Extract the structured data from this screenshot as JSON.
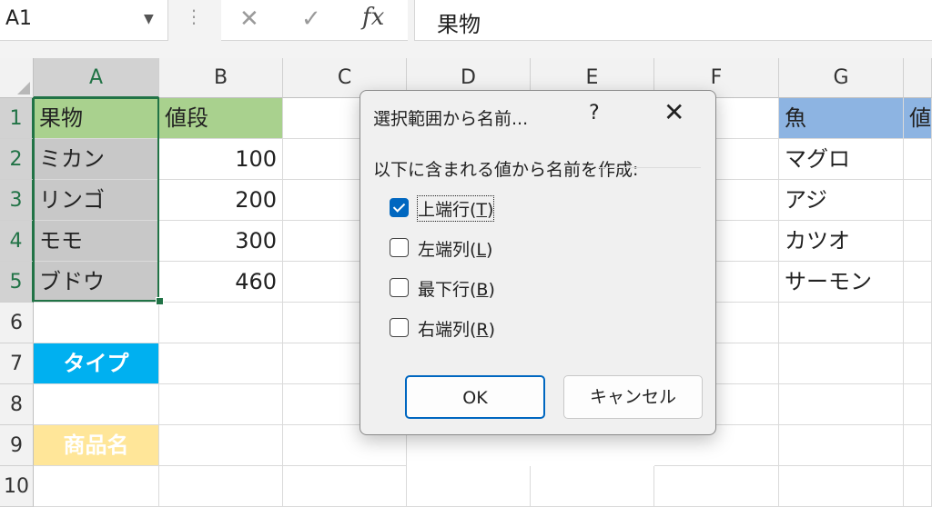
{
  "formula_bar": {
    "name_box": "A1",
    "dots": "⋮",
    "cancel_icon": "✕",
    "enter_icon": "✓",
    "fx_label": "fx",
    "value": "果物"
  },
  "columns": [
    "A",
    "B",
    "C",
    "D",
    "E",
    "F",
    "G"
  ],
  "rows": [
    "1",
    "2",
    "3",
    "4",
    "5",
    "6",
    "7",
    "8",
    "9",
    "10"
  ],
  "cells": {
    "A1": "果物",
    "B1": "値段",
    "A2": "ミカン",
    "B2": "100",
    "A3": "リンゴ",
    "B3": "200",
    "A4": "モモ",
    "B4": "300",
    "A5": "ブドウ",
    "B5": "460",
    "A7": "タイプ",
    "A9": "商品名",
    "G1": "魚",
    "H1": "値",
    "G2": "マグロ",
    "G3": "アジ",
    "G4": "カツオ",
    "G5": "サーモン"
  },
  "colors": {
    "header_green": "#a9d18e",
    "selection_gray": "#c8c8c8",
    "header_blue": "#8db4e2",
    "type_cyan": "#00b0f0",
    "name_yellow": "#ffe699",
    "excel_green": "#217346",
    "check_blue": "#0067c0"
  },
  "dialog": {
    "title": "選択範囲から名前...",
    "help": "?",
    "close": "✕",
    "description": "以下に含まれる値から名前を作成:",
    "options": [
      {
        "label_pre": "上端行(",
        "key": "T",
        "label_post": ")",
        "checked": true
      },
      {
        "label_pre": "左端列(",
        "key": "L",
        "label_post": ")",
        "checked": false
      },
      {
        "label_pre": "最下行(",
        "key": "B",
        "label_post": ")",
        "checked": false
      },
      {
        "label_pre": "右端列(",
        "key": "R",
        "label_post": ")",
        "checked": false
      }
    ],
    "ok_label": "OK",
    "cancel_label": "キャンセル"
  }
}
